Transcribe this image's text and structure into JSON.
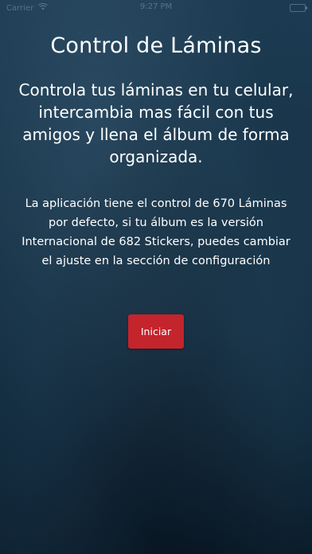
{
  "status_bar": {
    "carrier": "Carrier",
    "time": "9:27 PM"
  },
  "title": "Control de Láminas",
  "subtitle": "Controla tus láminas en tu celular, intercambia mas fácil con tus amigos y llena el álbum de forma organizada.",
  "description": "La aplicación tiene el control de 670 Láminas por defecto, si tu álbum es la versión Internacional de 682 Stickers, puedes cambiar el ajuste en la sección de configuración",
  "start_button": {
    "label": "Iniciar",
    "color": "#c4242c"
  },
  "theme": {
    "background": "#173246",
    "text": "#ffffff"
  }
}
